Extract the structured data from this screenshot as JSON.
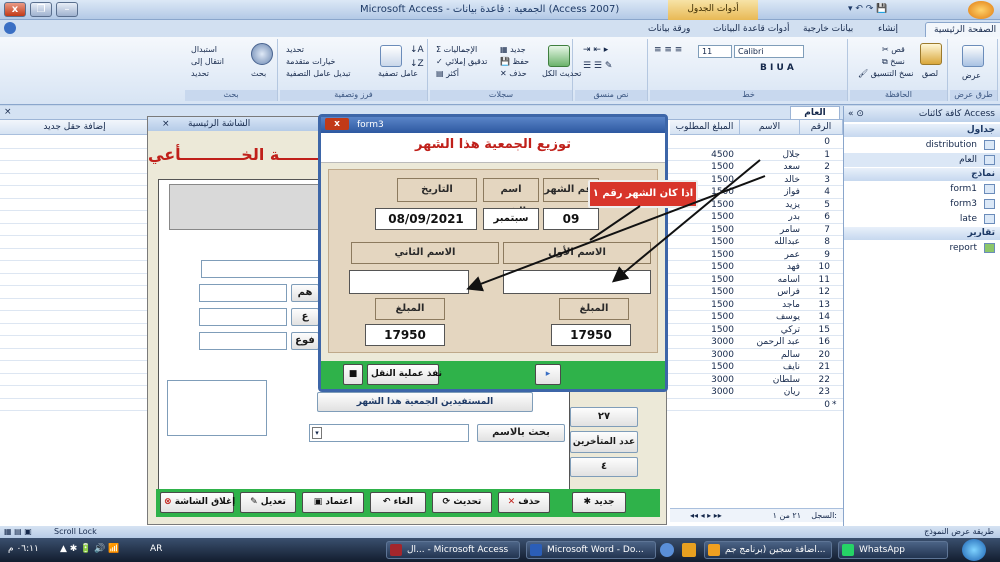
{
  "window": {
    "title": "Microsoft Access - الجمعية : قاعدة بيانات (Access 2007)",
    "context_tab": "أدوات الجدول"
  },
  "ribbon_tabs": [
    "الصفحة الرئيسية",
    "إنشاء",
    "بيانات خارجية",
    "أدوات قاعدة البيانات",
    "ورقة بيانات"
  ],
  "ribbon": {
    "views": {
      "label": "طرق عرض",
      "button": "عرض"
    },
    "clipboard": {
      "label": "الحافظة",
      "paste": "لصق",
      "cut": "قص",
      "copy": "نسخ",
      "format_painter": "نسخ التنسيق"
    },
    "font": {
      "label": "خط",
      "font_name": "Calibri",
      "font_size": "11"
    },
    "rich_text": {
      "label": "نص منسق"
    },
    "records": {
      "label": "سجلات",
      "refresh_all": "تحديث الكل",
      "new": "جديد",
      "save": "حفظ",
      "delete": "حذف",
      "totals": "الإجماليات",
      "spelling": "تدقيق إملائي",
      "more": "أكثر"
    },
    "sort_filter": {
      "label": "فرز وتصفية",
      "filter": "عامل تصفية",
      "selection": "تحديد",
      "advanced": "خيارات متقدمة",
      "toggle_filter": "تبديل عامل التصفية"
    },
    "find": {
      "label": "بحث",
      "find": "بحث",
      "replace": "استبدال",
      "goto": "انتقال إلى",
      "select": "تحديد"
    }
  },
  "nav_pane": {
    "title": "كافة كائنات Access",
    "groups": [
      {
        "name": "جداول",
        "items": [
          "distribution",
          "العام"
        ]
      },
      {
        "name": "نماذج",
        "items": [
          "form1",
          "form3",
          "late"
        ]
      },
      {
        "name": "تقارير",
        "items": [
          "report"
        ]
      }
    ]
  },
  "table": {
    "tab_label": "العام",
    "columns": [
      "الرقم",
      "الاسم",
      "المبلغ المطلوب",
      "إضافة حقل جديد"
    ],
    "rows": [
      {
        "id": "0",
        "name": "",
        "amount": ""
      },
      {
        "id": "1",
        "name": "جلال",
        "amount": "4500"
      },
      {
        "id": "2",
        "name": "سعد",
        "amount": "1500"
      },
      {
        "id": "3",
        "name": "خالد",
        "amount": "1500"
      },
      {
        "id": "4",
        "name": "فواز",
        "amount": "1500"
      },
      {
        "id": "5",
        "name": "يزيد",
        "amount": "1500"
      },
      {
        "id": "6",
        "name": "بدر",
        "amount": "1500"
      },
      {
        "id": "7",
        "name": "سامر",
        "amount": "1500"
      },
      {
        "id": "8",
        "name": "عبدالله",
        "amount": "1500"
      },
      {
        "id": "9",
        "name": "عمر",
        "amount": "1500"
      },
      {
        "id": "10",
        "name": "فهد",
        "amount": "1500"
      },
      {
        "id": "11",
        "name": "اسامه",
        "amount": "1500"
      },
      {
        "id": "12",
        "name": "فراس",
        "amount": "1500"
      },
      {
        "id": "13",
        "name": "ماجد",
        "amount": "1500"
      },
      {
        "id": "14",
        "name": "يوسف",
        "amount": "1500"
      },
      {
        "id": "15",
        "name": "تركي",
        "amount": "1500"
      },
      {
        "id": "16",
        "name": "عبد الرحمن",
        "amount": "3000"
      },
      {
        "id": "20",
        "name": "سالم",
        "amount": "3000"
      },
      {
        "id": "21",
        "name": "نايف",
        "amount": "1500"
      },
      {
        "id": "22",
        "name": "سلطان",
        "amount": "3000"
      },
      {
        "id": "23",
        "name": "ريان",
        "amount": "3000"
      },
      {
        "id": "0",
        "name": "",
        "amount": ""
      }
    ],
    "new_row_marker": "*",
    "record_nav": {
      "label": "السجل:",
      "position": "٢١ من ١"
    }
  },
  "main_form": {
    "caption": "الشاشة الرئيسية",
    "header_text": "الجمعيـــــــة الخـــــــــــأعي",
    "side_labels": [
      "هم",
      "ع",
      "فوع"
    ],
    "count_value": "٢٧",
    "late_label": "عدد المتأخرين",
    "late_value": "٤",
    "search_label": "بحث بالاسم",
    "members_button": "المستفيدين الجمعية هذا الشهر",
    "buttons": {
      "close": "إغلاق الشاشة",
      "edit": "تعديل",
      "approve": "اعتماد",
      "cancel": "الغاء",
      "refresh": "تحديث",
      "delete": "حذف",
      "new": "جديد"
    }
  },
  "form3": {
    "caption": "form3",
    "title": "توزيع الجمعية هذا الشهر",
    "labels": {
      "month_no": "رقم الشهر",
      "month_name": "اسم الشهر",
      "date": "التاريخ",
      "first_name": "الاسم الأول",
      "second_name": "الاسم الثاني",
      "amount1": "المبلغ",
      "amount2": "المبلغ"
    },
    "values": {
      "month_no": "09",
      "month_name": "سبتمبر",
      "date": "08/09/2021",
      "first_name": "",
      "second_name": "",
      "amount1": "17950",
      "amount2": "17950"
    },
    "transfer_button": "نفذ عملية النقل"
  },
  "callout": "اذا كان الشهر رقم ١",
  "status_bar": {
    "left": "Scroll Lock",
    "right": "طريقة عرض النموذج"
  },
  "taskbar": {
    "buttons": [
      "WhatsApp",
      "اضافة سجين (برنامج جم...",
      "Microsoft Word - Do...",
      "ال... - Microsoft Access"
    ],
    "lang": "AR",
    "clock": "٠٦:١١ م"
  },
  "colors": {
    "accent_green": "#2fb24a",
    "title_red": "#c0201a",
    "callout_red": "#d8352b"
  }
}
